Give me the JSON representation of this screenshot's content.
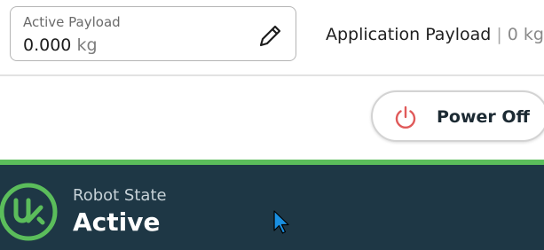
{
  "header": {
    "active_payload": {
      "label": "Active Payload",
      "value": "0.000",
      "unit": "kg",
      "edit_icon": "pencil-icon"
    },
    "application_payload": {
      "label": "Application Payload",
      "separator": "|",
      "value": "0 kg"
    }
  },
  "power": {
    "label": "Power Off",
    "icon": "power-icon",
    "icon_color": "#e05a5a"
  },
  "status": {
    "label": "Robot State",
    "value": "Active",
    "logo": "ur-logo",
    "accent_color": "#5bbd5b",
    "background_color": "#1e3745"
  },
  "cursor": {
    "icon": "mouse-pointer-icon"
  }
}
